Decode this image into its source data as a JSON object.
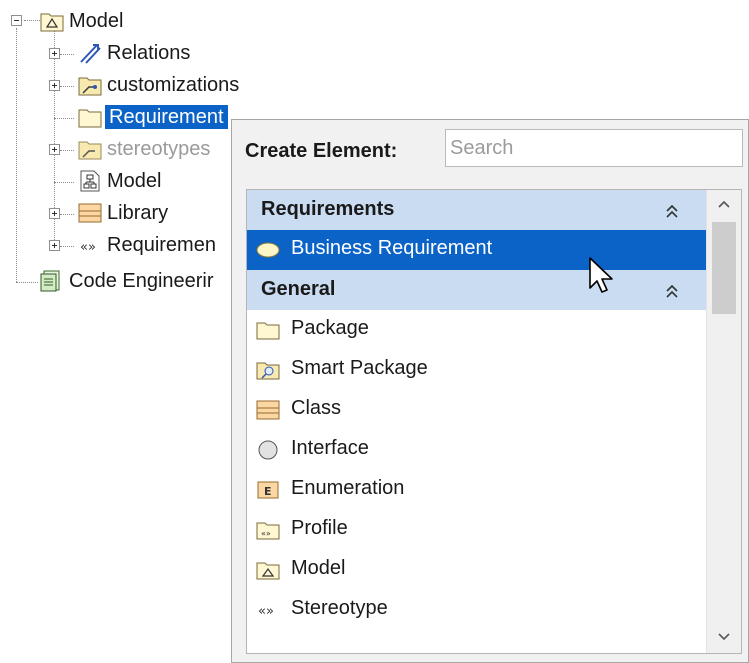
{
  "tree": {
    "nodes": [
      {
        "label": "Model",
        "icon": "model-package-icon",
        "expander": "minus"
      },
      {
        "label": "Relations",
        "icon": "relations-icon",
        "expander": "plus"
      },
      {
        "label": "customizations",
        "icon": "customization-package-icon",
        "expander": "plus"
      },
      {
        "label": "Requirement",
        "icon": "package-folder-icon",
        "selected": true
      },
      {
        "label": "stereotypes",
        "icon": "stereotype-package-icon",
        "expander": "plus",
        "muted": true
      },
      {
        "label": "Model",
        "icon": "diagram-icon"
      },
      {
        "label": "Library",
        "icon": "class-icon",
        "expander": "plus"
      },
      {
        "label": "Requiremen",
        "icon": "stereotype-guillemets-icon",
        "expander": "plus"
      },
      {
        "label": "Code Engineerir",
        "icon": "code-engineering-icon"
      }
    ]
  },
  "popup": {
    "title": "Create Element:",
    "search_placeholder": "Search",
    "groups": [
      {
        "label": "Requirements",
        "items": [
          "Business Requirement"
        ]
      },
      {
        "label": "General",
        "items": [
          "Package",
          "Smart Package",
          "Class",
          "Interface",
          "Enumeration",
          "Profile",
          "Model",
          "Stereotype"
        ]
      }
    ],
    "highlighted_item": "Business Requirement"
  },
  "colors": {
    "selection": "#0b63c7",
    "group_header": "#c9dcf2",
    "popup_background": "#f1f1f1"
  }
}
